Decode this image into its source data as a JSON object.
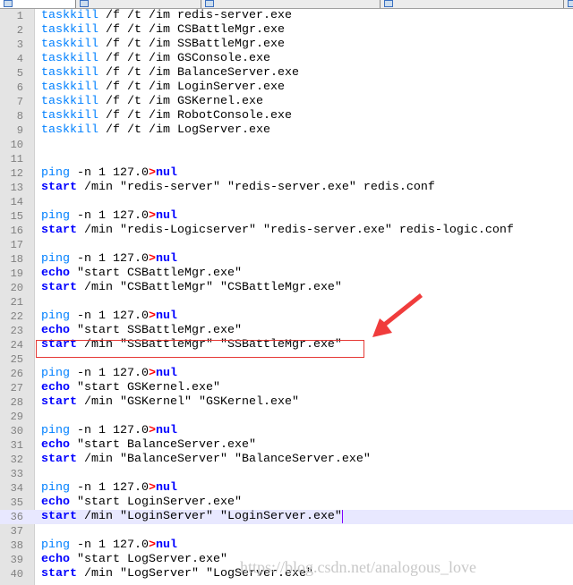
{
  "tabs": [
    "",
    "",
    "",
    "",
    "",
    "",
    ""
  ],
  "current_line": 36,
  "lines": [
    [
      [
        "k1",
        "taskkill"
      ],
      [
        "",
        "/f /t /im redis-server.exe"
      ]
    ],
    [
      [
        "k1",
        "taskkill"
      ],
      [
        "",
        "/f /t /im CSBattleMgr.exe"
      ]
    ],
    [
      [
        "k1",
        "taskkill"
      ],
      [
        "",
        "/f /t /im SSBattleMgr.exe"
      ]
    ],
    [
      [
        "k1",
        "taskkill"
      ],
      [
        "",
        "/f /t /im GSConsole.exe"
      ]
    ],
    [
      [
        "k1",
        "taskkill"
      ],
      [
        "",
        "/f /t /im BalanceServer.exe"
      ]
    ],
    [
      [
        "k1",
        "taskkill"
      ],
      [
        "",
        "/f /t /im LoginServer.exe"
      ]
    ],
    [
      [
        "k1",
        "taskkill"
      ],
      [
        "",
        "/f /t /im GSKernel.exe"
      ]
    ],
    [
      [
        "k1",
        "taskkill"
      ],
      [
        "",
        "/f /t /im RobotConsole.exe"
      ]
    ],
    [
      [
        "k1",
        "taskkill"
      ],
      [
        "",
        "/f /t /im LogServer.exe"
      ]
    ],
    [],
    [],
    [
      [
        "k1",
        "ping"
      ],
      [
        "",
        "-n 1 127.0"
      ],
      [
        "op",
        ">"
      ],
      [
        "k2",
        "nul"
      ]
    ],
    [
      [
        "k2",
        "start"
      ],
      [
        "",
        "/min \"redis-server\" \"redis-server.exe\" redis.conf"
      ]
    ],
    [],
    [
      [
        "k1",
        "ping"
      ],
      [
        "",
        "-n 1 127.0"
      ],
      [
        "op",
        ">"
      ],
      [
        "k2",
        "nul"
      ]
    ],
    [
      [
        "k2",
        "start"
      ],
      [
        "",
        "/min \"redis-Logicserver\" \"redis-server.exe\" redis-logic.conf"
      ]
    ],
    [],
    [
      [
        "k1",
        "ping"
      ],
      [
        "",
        "-n 1 127.0"
      ],
      [
        "op",
        ">"
      ],
      [
        "k2",
        "nul"
      ]
    ],
    [
      [
        "k2",
        "echo"
      ],
      [
        "",
        "\"start CSBattleMgr.exe\""
      ]
    ],
    [
      [
        "k2",
        "start"
      ],
      [
        "",
        "/min \"CSBattleMgr\" \"CSBattleMgr.exe\""
      ]
    ],
    [],
    [
      [
        "k1",
        "ping"
      ],
      [
        "",
        "-n 1 127.0"
      ],
      [
        "op",
        ">"
      ],
      [
        "k2",
        "nul"
      ]
    ],
    [
      [
        "k2",
        "echo"
      ],
      [
        "",
        "\"start SSBattleMgr.exe\""
      ]
    ],
    [
      [
        "k2",
        "start"
      ],
      [
        "",
        "/min \"SSBattleMgr\" \"SSBattleMgr.exe\""
      ]
    ],
    [],
    [
      [
        "k1",
        "ping"
      ],
      [
        "",
        "-n 1 127.0"
      ],
      [
        "op",
        ">"
      ],
      [
        "k2",
        "nul"
      ]
    ],
    [
      [
        "k2",
        "echo"
      ],
      [
        "",
        "\"start GSKernel.exe\""
      ]
    ],
    [
      [
        "k2",
        "start"
      ],
      [
        "",
        "/min \"GSKernel\" \"GSKernel.exe\""
      ]
    ],
    [],
    [
      [
        "k1",
        "ping"
      ],
      [
        "",
        "-n 1 127.0"
      ],
      [
        "op",
        ">"
      ],
      [
        "k2",
        "nul"
      ]
    ],
    [
      [
        "k2",
        "echo"
      ],
      [
        "",
        "\"start BalanceServer.exe\""
      ]
    ],
    [
      [
        "k2",
        "start"
      ],
      [
        "",
        "/min \"BalanceServer\" \"BalanceServer.exe\""
      ]
    ],
    [],
    [
      [
        "k1",
        "ping"
      ],
      [
        "",
        "-n 1 127.0"
      ],
      [
        "op",
        ">"
      ],
      [
        "k2",
        "nul"
      ]
    ],
    [
      [
        "k2",
        "echo"
      ],
      [
        "",
        "\"start LoginServer.exe\""
      ]
    ],
    [
      [
        "k2",
        "start"
      ],
      [
        "",
        "/min \"LoginServer\" \"LoginServer.exe\""
      ]
    ],
    [],
    [
      [
        "k1",
        "ping"
      ],
      [
        "",
        "-n 1 127.0"
      ],
      [
        "op",
        ">"
      ],
      [
        "k2",
        "nul"
      ]
    ],
    [
      [
        "k2",
        "echo"
      ],
      [
        "",
        "\"start LogServer.exe\""
      ]
    ],
    [
      [
        "k2",
        "start"
      ],
      [
        "",
        "/min \"LogServer\" \"LogServer.exe\""
      ]
    ]
  ],
  "watermark": "https://blog.csdn.net/analogous_love",
  "annotation_color": "#e53935"
}
